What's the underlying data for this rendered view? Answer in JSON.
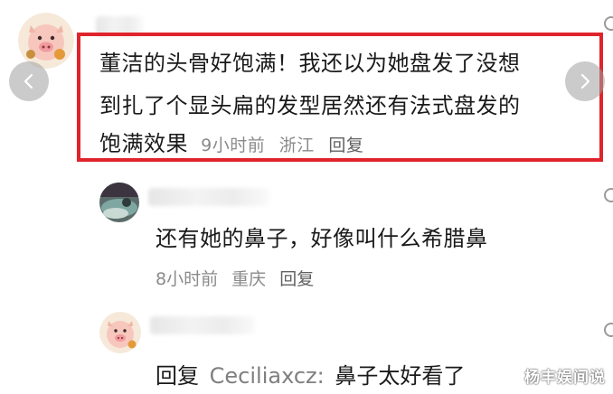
{
  "main_comment": {
    "line1": "董洁的头骨好饱满！我还以为她盘发了没想",
    "line2": "到扎了个显头扁的发型居然还有法式盘发的",
    "line3": "饱满效果",
    "time": "9小时前",
    "location": "浙江",
    "reply_label": "回复"
  },
  "reply1": {
    "text": "还有她的鼻子，好像叫什么希腊鼻",
    "time": "8小时前",
    "location": "重庆",
    "reply_label": "回复"
  },
  "reply2": {
    "reply_word": "回复",
    "mention": "Ceciliaxcz:",
    "text": "鼻子太好看了"
  },
  "watermark": "杨丰娱间说",
  "icons": {
    "prev": "chevron-left-icon",
    "next": "chevron-right-icon",
    "more": "more-circle-icon"
  },
  "colors": {
    "highlight": "#e0242b",
    "meta": "#8a8a8a"
  }
}
